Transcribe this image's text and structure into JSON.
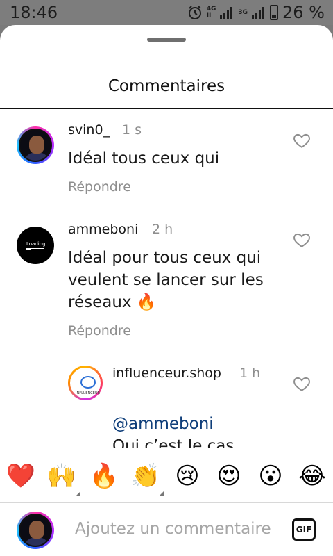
{
  "status_bar": {
    "time": "18:46",
    "net_top": "4G",
    "net_bottom": "II",
    "net2": "3G",
    "battery": "26 %"
  },
  "sheet": {
    "title": "Commentaires"
  },
  "comments": [
    {
      "user": "svin0_",
      "time": "1 s",
      "text": "Idéal tous ceux qui",
      "reply": "Répondre"
    },
    {
      "user": "ammeboni",
      "time": "2 h",
      "text": "Idéal pour tous ceux qui veulent se lancer sur les réseaux 🔥",
      "reply": "Répondre",
      "avatar_text": "Loading"
    },
    {
      "user": "influenceur.shop",
      "time": "1 h",
      "mention": "@ammeboni",
      "text": "Oui c’est le cas.\nOn vous invite à",
      "avatar_text": "INFLUENCEUR"
    }
  ],
  "emoji_bar": [
    "❤️",
    "🙌",
    "🔥",
    "👏",
    "😢",
    "😍",
    "😮",
    "😂"
  ],
  "input": {
    "placeholder": "Ajoutez un commentaire",
    "gif_label": "GIF"
  }
}
